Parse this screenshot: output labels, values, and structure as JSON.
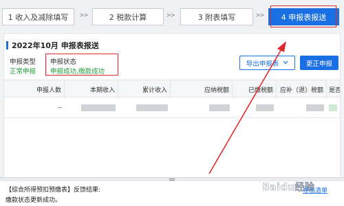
{
  "steps": [
    {
      "label": "1 收入及减除填写"
    },
    {
      "label": "2 税款计算"
    },
    {
      "label": "3 附表填写"
    },
    {
      "label": "4 申报表报送"
    }
  ],
  "step_separator": ">>",
  "active_step": 4,
  "report": {
    "title": "2022年10月  申报表报送",
    "type_label": "申报类型",
    "type_value": "正常申报",
    "status_label": "申报状态",
    "status_value": "申报成功,缴款成功"
  },
  "buttons": {
    "export_label": "导出申报表",
    "correct_label": "更正申报"
  },
  "table": {
    "columns": [
      "申报人数",
      "本期收入",
      "累计收入",
      "应纳税额",
      "已缴税额",
      "应补（退）税额",
      "是否"
    ],
    "row": {
      "count": "--"
    }
  },
  "feedback": {
    "line1": "【综合所得预扣预缴表】反馈结果:",
    "line2": "缴款状态更新成功。",
    "link": "导出清单"
  },
  "watermark": "Baidu经验",
  "colors": {
    "accent": "#1a6fe3",
    "success": "#1f9e3a",
    "annotation": "#e0292b"
  }
}
